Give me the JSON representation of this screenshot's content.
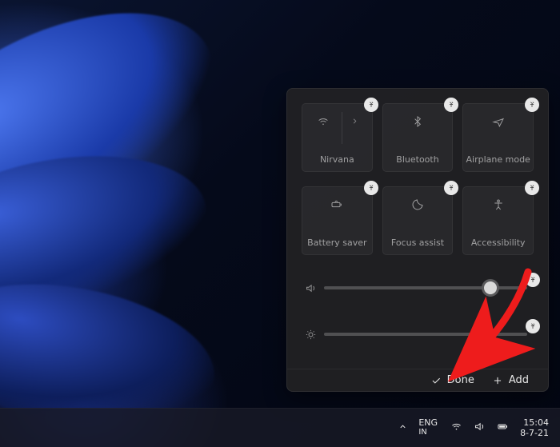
{
  "panel": {
    "tiles": [
      {
        "name": "wifi",
        "label": "Nirvana",
        "has_chevron": true
      },
      {
        "name": "bluetooth",
        "label": "Bluetooth",
        "has_chevron": false
      },
      {
        "name": "airplane",
        "label": "Airplane mode",
        "has_chevron": false
      },
      {
        "name": "battery-saver",
        "label": "Battery saver",
        "has_chevron": false
      },
      {
        "name": "focus-assist",
        "label": "Focus assist",
        "has_chevron": false
      },
      {
        "name": "accessibility",
        "label": "Accessibility",
        "has_chevron": false
      }
    ],
    "sliders": {
      "volume": {
        "percent": 82
      },
      "brightness": {
        "percent": 80
      }
    },
    "footer": {
      "done_label": "Done",
      "add_label": "Add"
    }
  },
  "taskbar": {
    "language": {
      "line1": "ENG",
      "line2": "IN"
    },
    "clock": {
      "time": "15:04",
      "date": "8-7-21"
    }
  }
}
